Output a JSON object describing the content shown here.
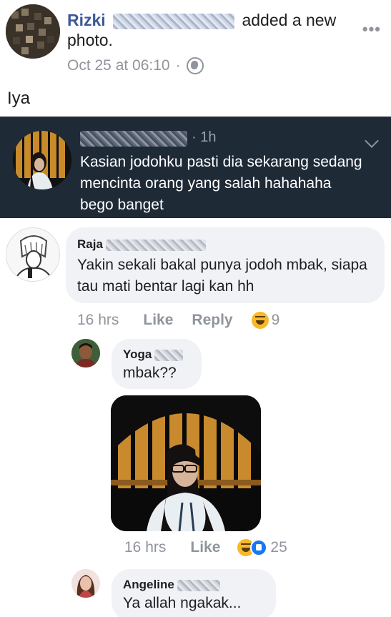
{
  "post": {
    "author_name": "Rizki",
    "action_text": "added a new photo.",
    "timestamp": "Oct 25 at 06:10",
    "separator": "·",
    "more_glyph": "•••",
    "body": "Iya"
  },
  "notification": {
    "time": "1h",
    "separator": "·",
    "text": "Kasian jodohku pasti dia sekarang sedang mencinta orang yang salah hahahaha bego banget"
  },
  "comments": [
    {
      "name": "Raja",
      "text": "Yakin sekali bakal punya jodoh mbak, siapa tau mati bentar lagi kan hh",
      "time": "16 hrs",
      "like_label": "Like",
      "reply_label": "Reply",
      "reaction_count": "9"
    },
    {
      "name": "Yoga",
      "text": "mbak??",
      "time": "16 hrs",
      "like_label": "Like",
      "reaction_count": "25"
    },
    {
      "name": "Angeline",
      "text": "Ya allah ngakak..."
    }
  ],
  "icons": {
    "globe": "globe-icon",
    "more": "more-options-icon",
    "chevron": "chevron-down-icon",
    "haha": "haha-reaction-icon",
    "like": "like-reaction-icon"
  },
  "colors": {
    "link_blue": "#3b5998",
    "dark_bar": "#1f2a37",
    "bubble_gray": "#f1f2f6",
    "meta_gray": "#90949c"
  }
}
